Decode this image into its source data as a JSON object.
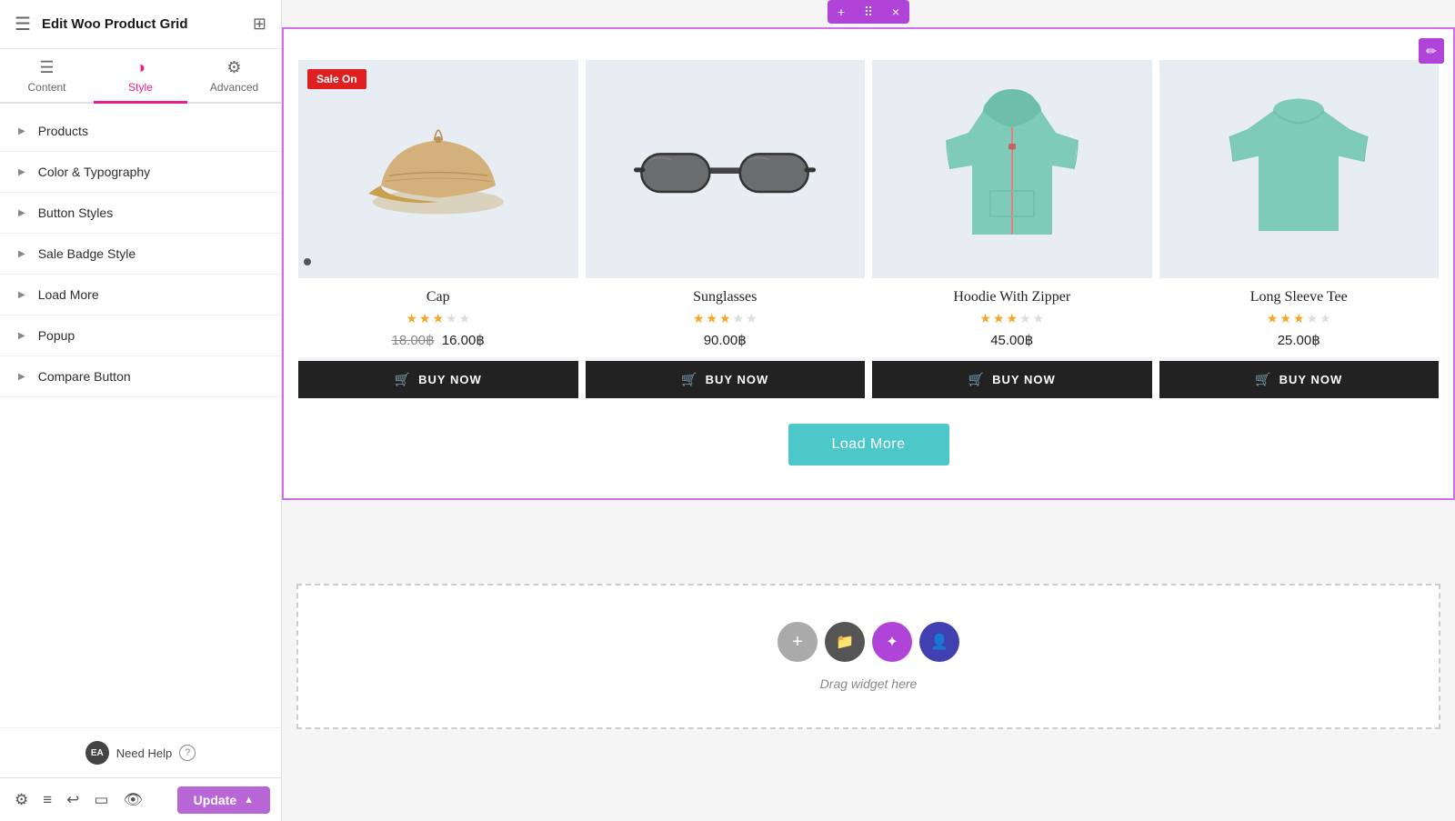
{
  "sidebar": {
    "title": "Edit Woo Product Grid",
    "tabs": [
      {
        "id": "content",
        "label": "Content",
        "icon": "☰"
      },
      {
        "id": "style",
        "label": "Style",
        "icon": "◑",
        "active": true
      },
      {
        "id": "advanced",
        "label": "Advanced",
        "icon": "⚙"
      }
    ],
    "accordion": [
      {
        "id": "products",
        "label": "Products"
      },
      {
        "id": "color-typography",
        "label": "Color & Typography"
      },
      {
        "id": "button-styles",
        "label": "Button Styles"
      },
      {
        "id": "sale-badge-style",
        "label": "Sale Badge Style"
      },
      {
        "id": "load-more",
        "label": "Load More"
      },
      {
        "id": "popup",
        "label": "Popup"
      },
      {
        "id": "compare-button",
        "label": "Compare Button"
      }
    ],
    "need_help": "Need Help",
    "bottom_icons": [
      "⚙",
      "≡",
      "↩",
      "▭",
      "👁"
    ],
    "update_btn": "Update"
  },
  "widget_toolbar": {
    "add": "+",
    "move": "⠿",
    "close": "×"
  },
  "products": [
    {
      "name": "Cap",
      "sale": true,
      "sale_label": "Sale On",
      "old_price": "18.00฿",
      "new_price": "16.00฿",
      "single_price": null,
      "stars": 5,
      "buy_label": "BUY NOW",
      "emoji": "🧢"
    },
    {
      "name": "Sunglasses",
      "sale": false,
      "sale_label": null,
      "old_price": null,
      "new_price": null,
      "single_price": "90.00฿",
      "stars": 5,
      "buy_label": "BUY NOW",
      "emoji": "🕶"
    },
    {
      "name": "Hoodie With Zipper",
      "sale": false,
      "sale_label": null,
      "old_price": null,
      "new_price": null,
      "single_price": "45.00฿",
      "stars": 5,
      "buy_label": "BUY NOW",
      "emoji": "🧥"
    },
    {
      "name": "Long Sleeve Tee",
      "sale": false,
      "sale_label": null,
      "old_price": null,
      "new_price": null,
      "single_price": "25.00฿",
      "stars": 5,
      "buy_label": "BUY NOW",
      "emoji": "👕"
    }
  ],
  "load_more_label": "Load More",
  "drag_widget_text": "Drag widget here",
  "colors": {
    "active_tab": "#e91e8c",
    "buy_btn_bg": "#222222",
    "load_more_bg": "#4dc8c8",
    "sale_badge": "#e02020",
    "widget_toolbar_bg": "#b044d8",
    "update_btn_bg": "#b967d6"
  }
}
